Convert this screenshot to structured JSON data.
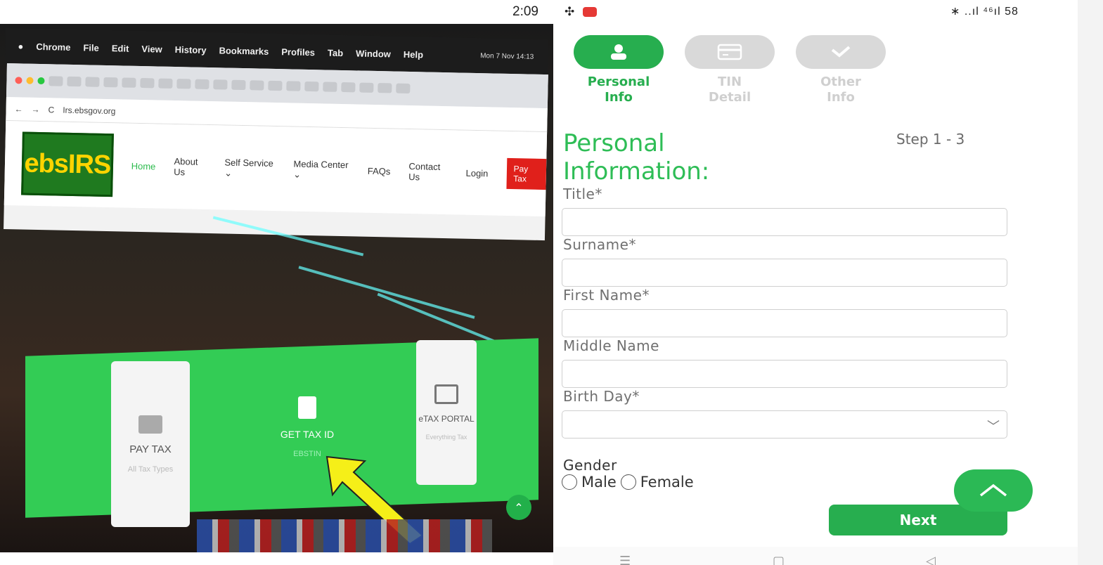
{
  "photo": {
    "mac_menubar": [
      "Chrome",
      "File",
      "Edit",
      "View",
      "History",
      "Bookmarks",
      "Profiles",
      "Tab",
      "Window",
      "Help"
    ],
    "mac_clock": "Mon 7 Nov 14:13",
    "url": "Irs.ebsgov.org",
    "logo_text": "ebsIRS",
    "nav": [
      "Home",
      "About Us",
      "Self Service ⌄",
      "Media Center ⌄",
      "FAQs",
      "Contact Us",
      "Login"
    ],
    "pay_tax_button": "Pay Tax",
    "cards": {
      "pay_tax": {
        "label": "PAY TAX",
        "sub": "All Tax Types"
      },
      "get_tax": {
        "label": "GET TAX ID",
        "sub": "EBSTIN"
      },
      "etax": {
        "label": "eTAX PORTAL",
        "sub": "Everything Tax"
      }
    },
    "colors": {
      "brand_green": "#33cc55",
      "pay_red": "#e0201b",
      "arrow_yellow": "#f5ef18"
    }
  },
  "phone": {
    "status": {
      "time": "2:09",
      "right": "∗ ..ıl ⁴⁶ıl 58"
    },
    "steps": [
      {
        "label_line1": "Personal",
        "label_line2": "Info",
        "icon": "user-icon",
        "active": true
      },
      {
        "label_line1": "TIN",
        "label_line2": "Detail",
        "icon": "card-icon",
        "active": false
      },
      {
        "label_line1": "Other",
        "label_line2": "Info",
        "icon": "check-icon",
        "active": false
      }
    ],
    "heading_line1": "Personal",
    "heading_line2": "Information:",
    "step_count": "Step 1 - 3",
    "fields": {
      "title": "Title*",
      "surname": "Surname*",
      "first_name": "First Name*",
      "middle_name": "Middle Name",
      "birth_day": "Birth Day*"
    },
    "gender": {
      "label": "Gender",
      "male": "Male",
      "female": "Female"
    },
    "next_button": "Next",
    "nav": {
      "menu": "☰",
      "home": "▢",
      "back": "◁"
    },
    "colors": {
      "accent": "#27ae4f",
      "inactive": "#d9d9d9"
    }
  }
}
